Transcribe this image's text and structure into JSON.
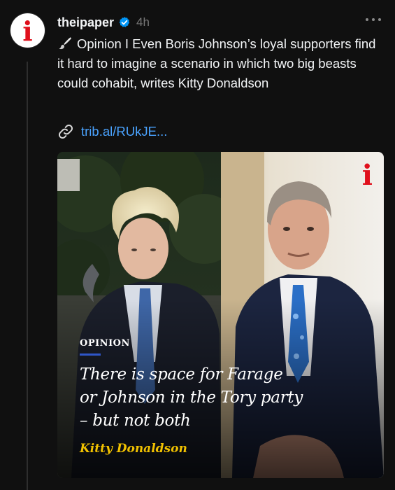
{
  "post": {
    "username": "theipaper",
    "timestamp": "4h",
    "avatar_letter": "i",
    "body": "Opinion I Even Boris Johnson’s loyal supporters find it hard to imagine a scenario in which two big beasts could cohabit, writes Kitty Donaldson",
    "link": "trib.al/RUkJE...",
    "icons": {
      "verified": "verified-badge-icon",
      "more": "more-options-icon",
      "brush": "paintbrush-icon",
      "link": "link-icon"
    }
  },
  "media": {
    "tag": "OPINION",
    "headline": "There is space for Farage or Johnson in the Tory party – but not both",
    "author": "Kitty Donaldson",
    "brand_mark": "i"
  },
  "colors": {
    "background": "#101010",
    "accent_link": "#4aa3ff",
    "verified": "#0095f6",
    "brand_red": "#e0101c",
    "author_yellow": "#f2c200",
    "rule_blue": "#2f56c9"
  }
}
